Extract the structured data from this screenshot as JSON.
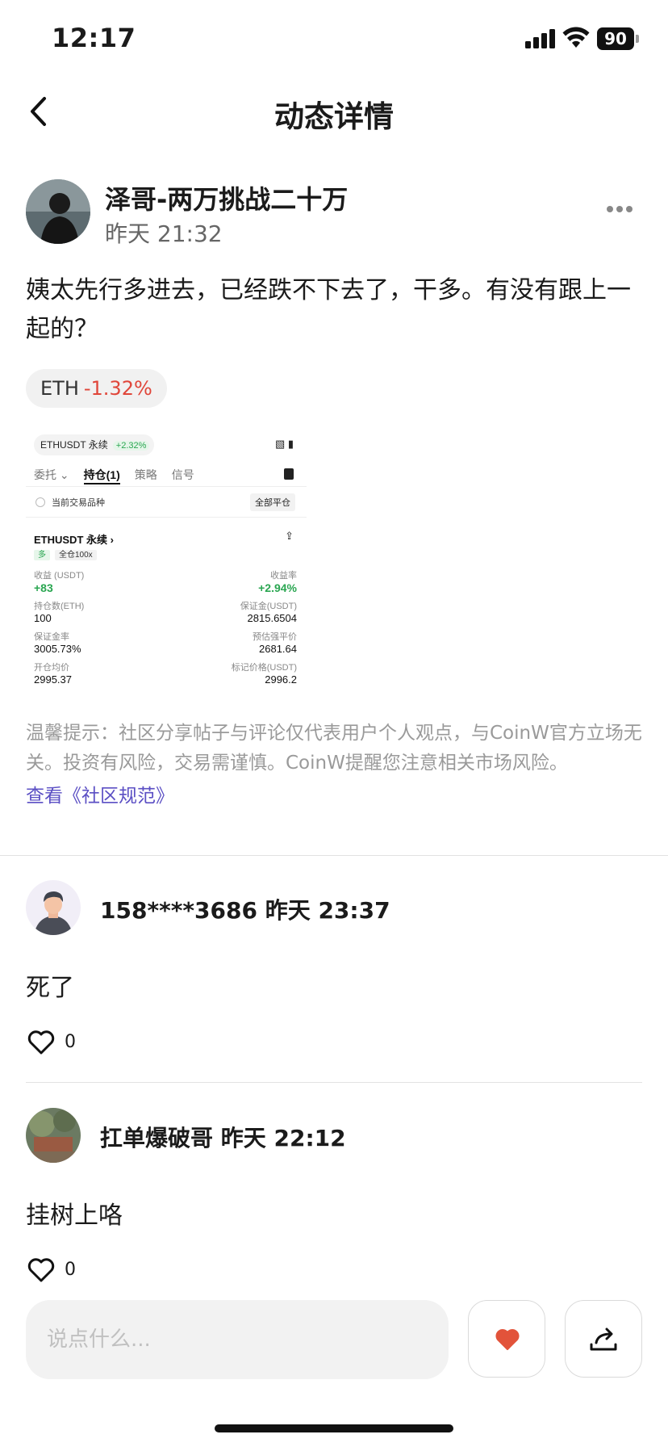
{
  "status_bar": {
    "time": "12:17",
    "battery": "90"
  },
  "nav": {
    "title": "动态详情"
  },
  "post": {
    "author": "泽哥-两万挑战二十万",
    "time": "昨天 21:32",
    "content": "姨太先行多进去，已经跌不下去了，干多。有没有跟上一起的？",
    "tag": {
      "symbol": "ETH",
      "change": "-1.32%"
    },
    "screenshot": {
      "pair": "ETHUSDT 永续",
      "pair_change": "+2.32%",
      "tabs": [
        "委托 ⌄",
        "持仓(1)",
        "策略",
        "信号"
      ],
      "current_label": "当前交易品种",
      "close_all": "全部平仓",
      "symbol": "ETHUSDT 永续 ›",
      "side_badge": "多",
      "margin_badge": "全仓100x",
      "pnl_label": "收益 (USDT)",
      "pnl_value": "+83",
      "roi_label": "收益率",
      "roi_value": "+2.94%",
      "qty_label": "持仓数(ETH)",
      "qty_value": "100",
      "margin_label": "保证金(USDT)",
      "margin_value": "2815.6504",
      "margin_ratio_label": "保证金率",
      "margin_ratio_value": "3005.73%",
      "liq_label": "预估强平价",
      "liq_value": "2681.64",
      "entry_label": "开仓均价",
      "entry_value": "2995.37",
      "mark_label": "标记价格(USDT)",
      "mark_value": "2996.2"
    },
    "notice": "温馨提示：社区分享帖子与评论仅代表用户个人观点，与CoinW官方立场无关。投资有风险，交易需谨慎。CoinW提醒您注意相关市场风险。",
    "notice_link": "查看《社区规范》"
  },
  "comments": [
    {
      "user": "158****3686 昨天 23:37",
      "text": "死了",
      "likes": "0"
    },
    {
      "user": "扛单爆破哥 昨天 22:12",
      "text": "挂树上咯",
      "likes": "0"
    }
  ],
  "composer": {
    "placeholder": "说点什么..."
  },
  "colors": {
    "down": "#e0463a",
    "up": "#2aa651",
    "link": "#5b4fc4",
    "like_active": "#e2533a"
  }
}
